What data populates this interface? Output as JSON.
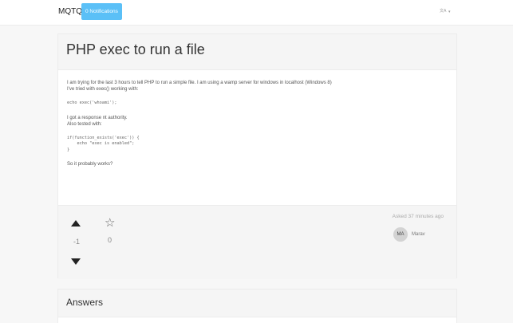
{
  "nav": {
    "brand": "MQTQ",
    "notifications_label": "0 Notifications",
    "language_icon": "translate-icon",
    "language_caret": "▾"
  },
  "question": {
    "title": "PHP exec to run a file",
    "body": {
      "p1": "I am trying for the last 3 hours to tell PHP to run a simple file. I am using a wamp server for windows in localhost (Windows 8)",
      "p2": "I've tried with exec() working with:",
      "code1": "echo exec('whoami');",
      "p3": "I got a response nt authority.",
      "p4": "Also tested with:",
      "code2": "if(function_exists('exec')) {\n    echo \"exec is enabled\";\n}",
      "p5": "So it probably works?"
    },
    "votes": "-1",
    "favorites": "0",
    "asked": "Asked 37 minutes ago",
    "author": {
      "initials": "MA",
      "name": "Marav"
    }
  },
  "answers": {
    "title": "Answers"
  },
  "colors": {
    "accent": "#5bc0f7",
    "panel": "#f5f5f5",
    "background": "#f7f7f7"
  }
}
